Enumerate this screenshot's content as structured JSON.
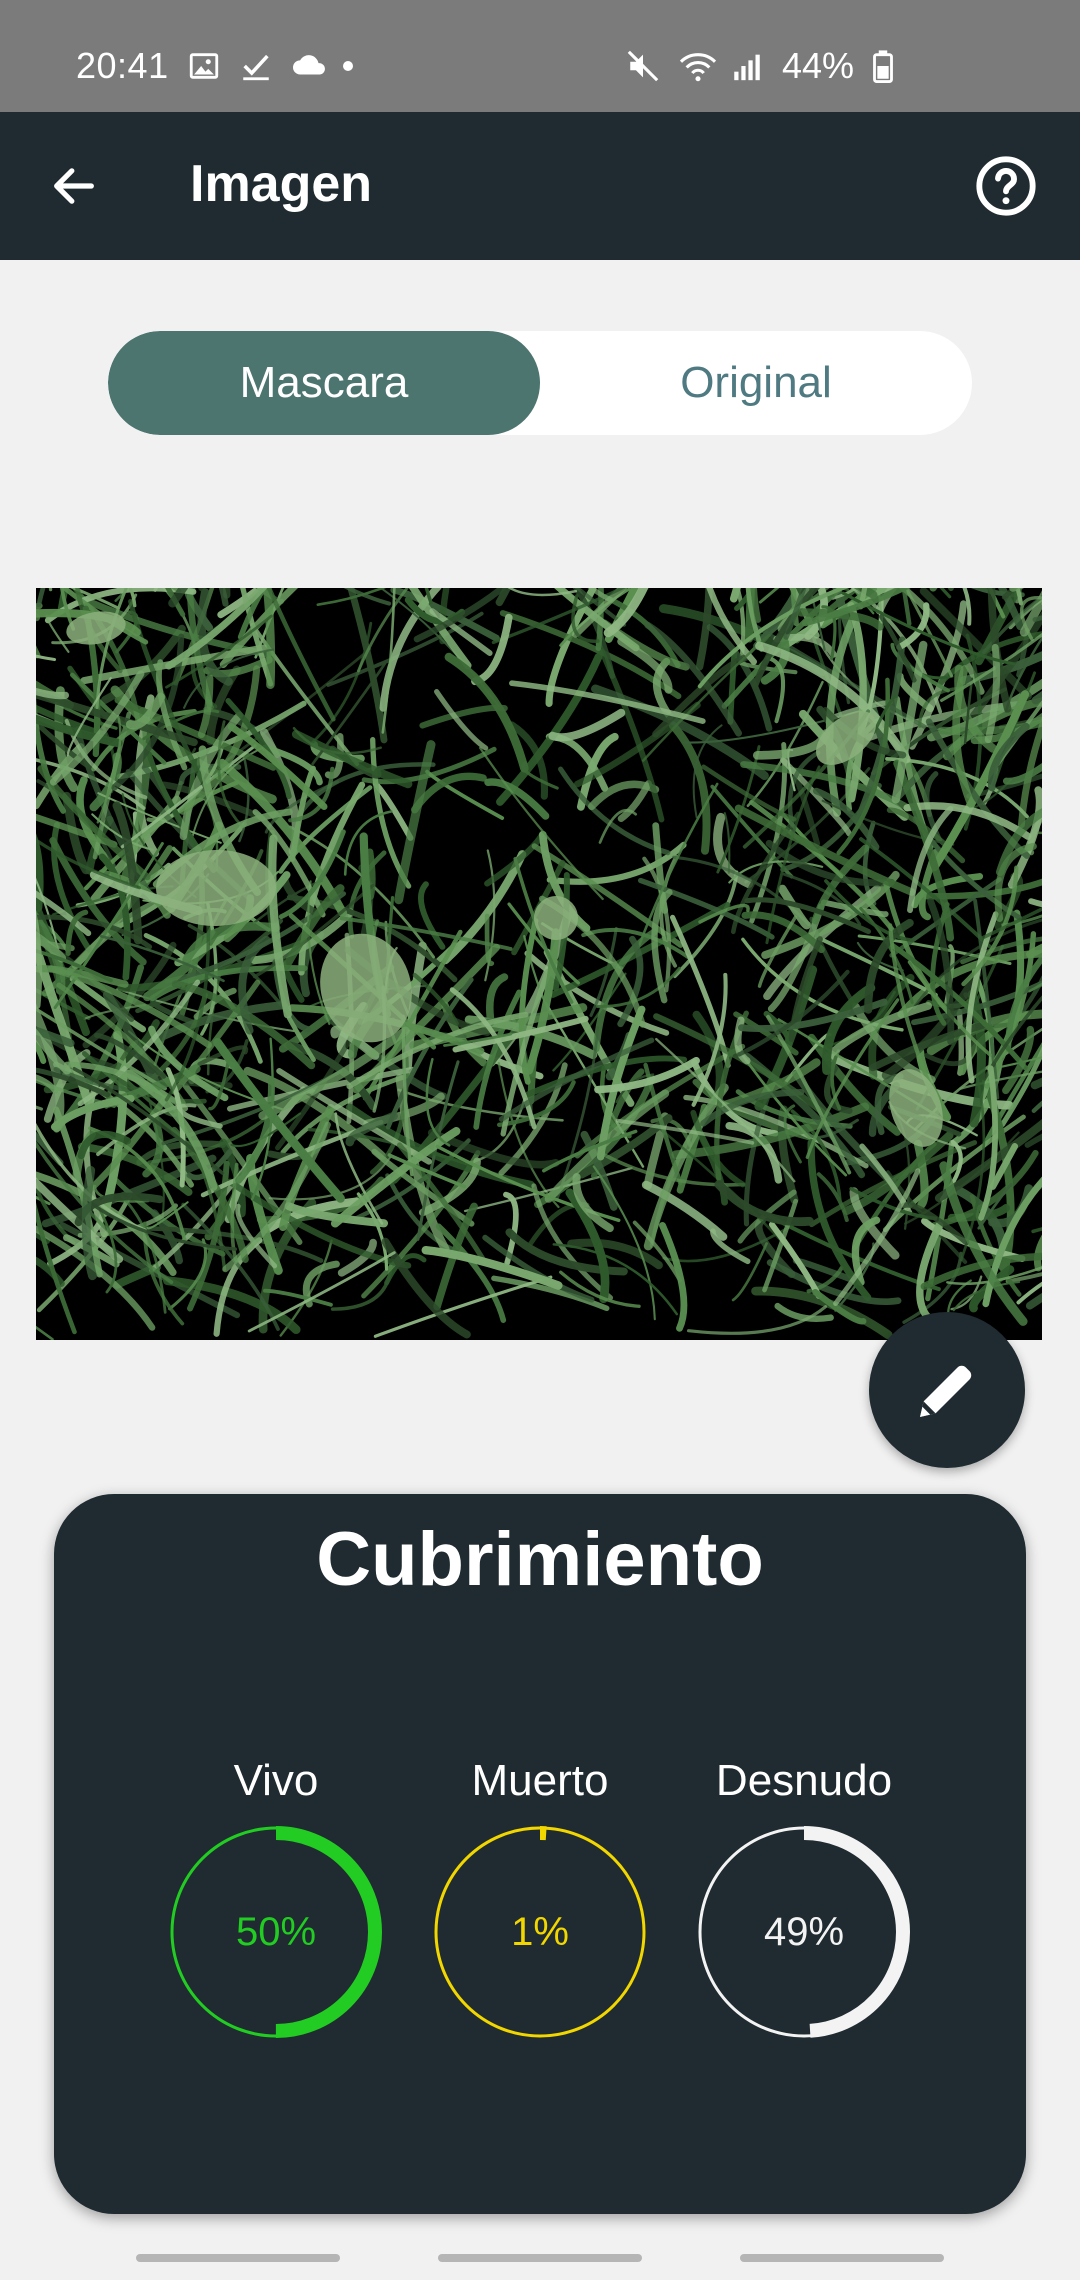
{
  "status_bar": {
    "time": "20:41",
    "battery": "44%",
    "left_icons": [
      "image-icon",
      "check-icon",
      "cloud-icon",
      "dot-icon"
    ],
    "right_icons": [
      "mute-icon",
      "wifi-icon",
      "signal-icon",
      "battery-icon"
    ]
  },
  "app_bar": {
    "title": "Imagen",
    "back_icon": "arrow-left-icon",
    "help_icon": "help-circle-icon"
  },
  "toggle": {
    "options": [
      "Mascara",
      "Original"
    ],
    "selected": "Mascara"
  },
  "image": {
    "description_icon": "mask-image"
  },
  "fab": {
    "icon": "pencil-icon"
  },
  "coverage": {
    "title": "Cubrimiento",
    "metrics": [
      {
        "label": "Vivo",
        "value": "50%",
        "fraction": 0.5,
        "color": "#22cc22"
      },
      {
        "label": "Muerto",
        "value": "1%",
        "fraction": 0.01,
        "color": "#f2d600"
      },
      {
        "label": "Desnudo",
        "value": "49%",
        "fraction": 0.49,
        "color": "#f3f3f3"
      }
    ]
  },
  "colors": {
    "app_bar": "#1f2b30",
    "status_bar": "#7b7b7b",
    "toggle_active": "#4c7570",
    "toggle_inactive_text": "#4f7a82",
    "background": "#f1f1f1"
  }
}
